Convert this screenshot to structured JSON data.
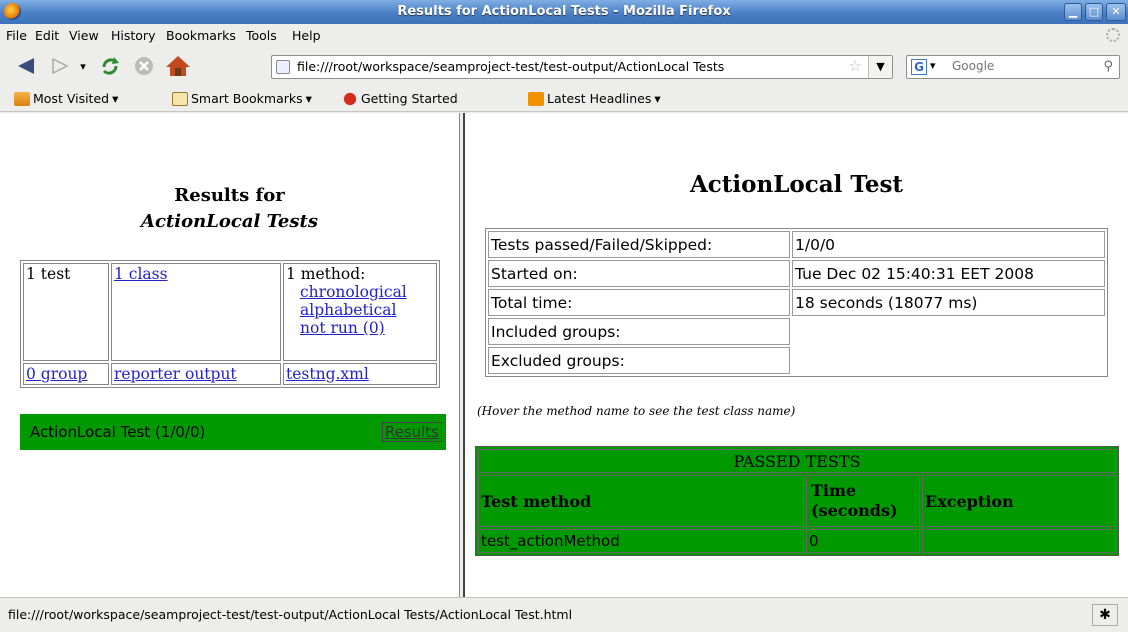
{
  "window": {
    "title": "Results for ActionLocal Tests - Mozilla Firefox"
  },
  "menu": [
    "File",
    "Edit",
    "View",
    "History",
    "Bookmarks",
    "Tools",
    "Help"
  ],
  "nav": {
    "url": "file:///root/workspace/seamproject-test/test-output/ActionLocal Tests",
    "search_placeholder": "Google",
    "search_engine_letter": "G"
  },
  "bookmarks": [
    "Most Visited",
    "Smart Bookmarks",
    "Getting Started",
    "Latest Headlines"
  ],
  "left": {
    "heading_line1": "Results for",
    "heading_line2": "ActionLocal Tests",
    "tests": "1 test",
    "classes": "1 class",
    "methods": "1 method:",
    "chronological": "chronological",
    "alphabetical": "alphabetical",
    "not_run": "not run (0)",
    "groups": "0 group",
    "reporter_output": "reporter output",
    "testng_xml": "testng.xml",
    "test_bar_label": "ActionLocal Test (1/0/0)",
    "test_bar_link": "Results"
  },
  "right": {
    "heading": "ActionLocal Test",
    "stats": [
      {
        "label": "Tests passed/Failed/Skipped:",
        "value": "1/0/0"
      },
      {
        "label": "Started on:",
        "value": "Tue Dec 02 15:40:31 EET 2008"
      },
      {
        "label": "Total time:",
        "value": "18 seconds (18077 ms)"
      },
      {
        "label": "Included groups:",
        "value": ""
      },
      {
        "label": "Excluded groups:",
        "value": ""
      }
    ],
    "hover_note": "(Hover the method name to see the test class name)",
    "passed_caption": "PASSED TESTS",
    "col_method": "Test method",
    "col_time": "Time (seconds)",
    "col_exception": "Exception",
    "rows": [
      {
        "method": "test_actionMethod",
        "time": "0",
        "exception": ""
      }
    ]
  },
  "status": {
    "text": "file:///root/workspace/seamproject-test/test-output/ActionLocal Tests/ActionLocal Test.html"
  },
  "colors": {
    "pass_green": "#009900",
    "titlebar_blue": "#4a7fc5",
    "link_blue": "#2222cc"
  },
  "icons": [
    "firefox-logo-icon",
    "back-arrow-icon",
    "forward-arrow-icon",
    "reload-icon",
    "stop-icon",
    "home-icon",
    "page-icon",
    "bookmark-star-icon",
    "search-magnifier-icon",
    "folder-icon",
    "rss-icon",
    "firefox-bookmark-icon",
    "bug-icon",
    "throbber-icon"
  ]
}
